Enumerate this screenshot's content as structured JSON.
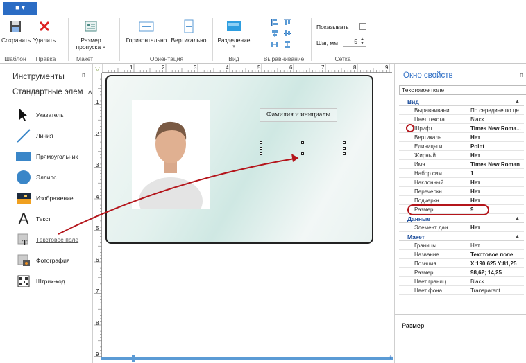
{
  "app_menu_label": "■ ▾",
  "ribbon": {
    "save": "Сохранить",
    "delete": "Удалить",
    "pass_size": "Размер пропуска ˅",
    "horizontal": "Горизонтально",
    "vertical": "Вертикально",
    "separator": "Разделение",
    "show_label": "Показывать",
    "step_label": "Шаг, мм",
    "step_value": "5",
    "groups": {
      "template": "Шаблон",
      "edit": "Правка",
      "layout": "Макет",
      "orientation": "Ориентация",
      "view": "Вид",
      "align": "Выравнивание",
      "grid": "Сетка"
    }
  },
  "tools": {
    "title": "Инструменты",
    "pin": "ᴨ",
    "section": "Стандартные элем",
    "items": [
      {
        "label": "Указатель",
        "icon": "pointer-icon"
      },
      {
        "label": "Линия",
        "icon": "line-icon"
      },
      {
        "label": "Прямоугольник",
        "icon": "rectangle-icon"
      },
      {
        "label": "Эллипс",
        "icon": "ellipse-icon"
      },
      {
        "label": "Изображение",
        "icon": "image-icon"
      },
      {
        "label": "Текст",
        "icon": "text-icon"
      },
      {
        "label": "Текстовое поле",
        "icon": "textfield-icon"
      },
      {
        "label": "Фотография",
        "icon": "photo-icon"
      },
      {
        "label": "Штрих-код",
        "icon": "barcode-icon"
      }
    ]
  },
  "ruler": {
    "h": [
      "1",
      "2",
      "3",
      "4",
      "5",
      "6",
      "7",
      "8",
      "9"
    ],
    "v": [
      "1",
      "2",
      "3",
      "4",
      "5",
      "6",
      "7",
      "8",
      "9"
    ]
  },
  "card": {
    "name_text": "Фамилия и инициалы"
  },
  "props": {
    "title": "Окно свойств",
    "pin": "ᴨ",
    "selector": "Текстовое поле",
    "sections": {
      "view": "Вид",
      "data": "Данные",
      "layout": "Макет"
    },
    "view_rows": [
      {
        "k": "Выравнивани...",
        "v": "По середине по це...",
        "bold": false
      },
      {
        "k": "Цвет текста",
        "v": "Black",
        "bold": false
      },
      {
        "k": "Шрифт",
        "v": "Times New Roma...",
        "bold": true
      },
      {
        "k": "Вертикаль...",
        "v": "Нет",
        "bold": true
      },
      {
        "k": "Единицы и...",
        "v": "Point",
        "bold": true
      },
      {
        "k": "Жирный",
        "v": "Нет",
        "bold": true
      },
      {
        "k": "Имя",
        "v": "Times New Roman",
        "bold": true
      },
      {
        "k": "Набор сим...",
        "v": "1",
        "bold": true
      },
      {
        "k": "Наклонный",
        "v": "Нет",
        "bold": true
      },
      {
        "k": "Перечеркн...",
        "v": "Нет",
        "bold": true
      },
      {
        "k": "Подчеркн...",
        "v": "Нет",
        "bold": true
      },
      {
        "k": "Размер",
        "v": "9",
        "bold": true
      }
    ],
    "data_rows": [
      {
        "k": "Элемент дан...",
        "v": "Нет",
        "bold": true
      }
    ],
    "layout_rows": [
      {
        "k": "Границы",
        "v": "Нет",
        "bold": false
      },
      {
        "k": "Название",
        "v": "Текстовое поле",
        "bold": true
      },
      {
        "k": "Позиция",
        "v": "X:190,625 Y:81,25",
        "bold": true
      },
      {
        "k": "Размер",
        "v": "98,62; 14,25",
        "bold": true
      },
      {
        "k": "Цвет границ",
        "v": "Black",
        "bold": false
      },
      {
        "k": "Цвет фона",
        "v": "Transparent",
        "bold": false
      }
    ],
    "description_title": "Размер"
  }
}
